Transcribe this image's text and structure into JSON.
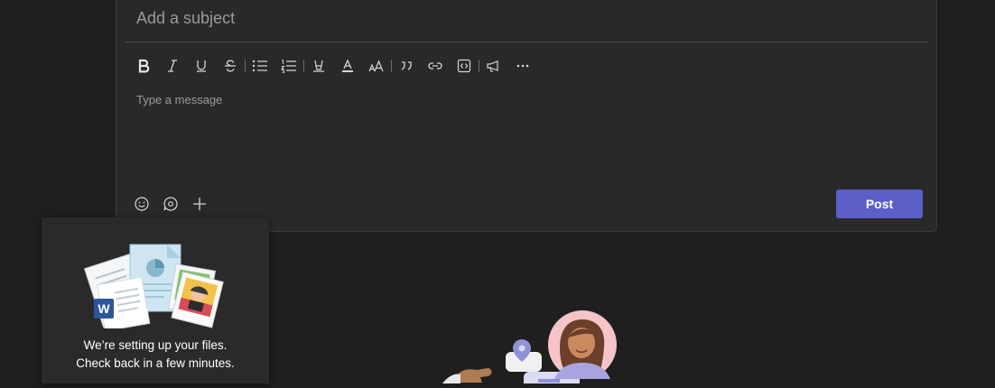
{
  "compose": {
    "subject_placeholder": "Add a subject",
    "message_placeholder": "Type a message",
    "post_label": "Post",
    "toolbar_icons": [
      "bold-icon",
      "italic-icon",
      "underline-icon",
      "strikethrough-icon",
      "bulleted-list-icon",
      "numbered-list-icon",
      "highlight-icon",
      "font-color-icon",
      "font-size-icon",
      "quote-icon",
      "link-icon",
      "code-snippet-icon",
      "announcement-icon",
      "more-options-icon"
    ],
    "bottom_icons": [
      "emoji-icon",
      "loop-component-icon",
      "add-icon"
    ]
  },
  "files_card": {
    "line1": "We’re setting up your files.",
    "line2": "Check back in a few minutes."
  },
  "colors": {
    "background": "#1f1f1f",
    "panel": "#292929",
    "accent": "#5b5fc7"
  }
}
